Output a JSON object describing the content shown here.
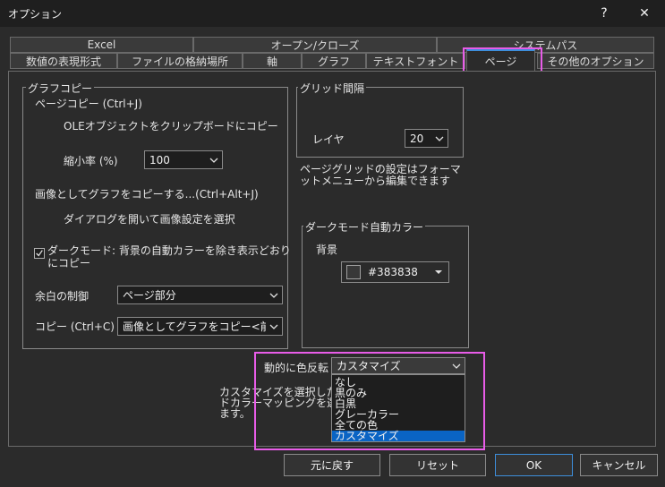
{
  "window": {
    "title": "オプション",
    "help_label": "?",
    "close_label": "✕"
  },
  "tabs_row1": [
    {
      "label": "Excel"
    },
    {
      "label": "オープン/クローズ"
    },
    {
      "label": "システムパス"
    }
  ],
  "tabs_row2": [
    {
      "label": "数値の表現形式"
    },
    {
      "label": "ファイルの格納場所"
    },
    {
      "label": "軸"
    },
    {
      "label": "グラフ"
    },
    {
      "label": "テキストフォント"
    },
    {
      "label": "ページ"
    },
    {
      "label": "その他のオプション"
    }
  ],
  "graph_copy": {
    "legend": "グラフコピー",
    "page_copy_label": "ページコピー (Ctrl+J)",
    "ole_text": "OLEオブジェクトをクリップボードにコピー",
    "scale_label": "縮小率 (%)",
    "scale_value": "100",
    "copy_as_image_label": "画像としてグラフをコピーする...(Ctrl+Alt+J)",
    "dialog_text": "ダイアログを開いて画像設定を選択",
    "darkmode_checked": true,
    "darkmode_text_line1": "ダークモード: 背景の自動カラーを除き表示どおり",
    "darkmode_text_line2": "にコピー",
    "margin_label": "余白の制御",
    "margin_value": "ページ部分",
    "copy_label": "コピー (Ctrl+C)",
    "copy_value": "画像としてグラフをコピー<前回と"
  },
  "grid_spacing": {
    "legend": "グリッド間隔",
    "layer_label": "レイヤ",
    "layer_value": "20",
    "note_line1": "ページグリッドの設定はフォーマ",
    "note_line2": "ットメニューから編集できます"
  },
  "darkmode_auto_color": {
    "legend": "ダークモード自動カラー",
    "bg_label": "背景",
    "bg_value": "#383838",
    "bg_color": "#383838"
  },
  "invert": {
    "label": "動的に色反転",
    "value": "カスタマイズ",
    "options": [
      "なし",
      "黒のみ",
      "白黒",
      "グレーカラー",
      "全ての色",
      "カスタマイズ"
    ],
    "selected_index": 5,
    "note_line1": "カスタマイズを選択した場",
    "note_line2": "ドカラーマッピングを選択",
    "note_line3": "ます。"
  },
  "buttons": {
    "revert": "元に戻す",
    "reset": "リセット",
    "ok": "OK",
    "cancel": "キャンセル"
  },
  "colors": {
    "highlight": "#e85ce8",
    "accent": "#3d8edb",
    "selection": "#0a64c4"
  }
}
